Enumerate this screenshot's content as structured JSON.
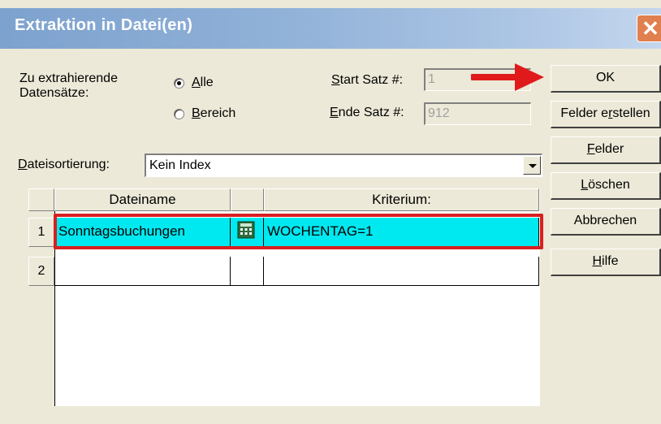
{
  "window": {
    "title": "Extraktion in Datei(en)",
    "close_symbol": "✕"
  },
  "records": {
    "label_line1": "Zu extrahierende",
    "label_line2": "Datensätze:",
    "radio_all": {
      "prefix": "",
      "accel": "A",
      "rest": "lle",
      "checked": true
    },
    "radio_range": {
      "prefix": "",
      "accel": "B",
      "rest": "ereich",
      "checked": false
    }
  },
  "start": {
    "accel": "S",
    "rest": "tart Satz #:",
    "value": "1"
  },
  "end": {
    "accel": "E",
    "rest": "nde Satz #:",
    "value": "912"
  },
  "sort": {
    "accel": "D",
    "rest": "ateisortierung:",
    "value": "Kein Index"
  },
  "buttons": {
    "ok": "OK",
    "create_pre": "Felder e",
    "create_accel": "r",
    "create_post": "stellen",
    "fields_accel": "F",
    "fields_rest": "elder",
    "delete_accel": "L",
    "delete_rest": "öschen",
    "cancel": "Abbrechen",
    "help_accel": "H",
    "help_rest": "ilfe"
  },
  "table": {
    "headers": {
      "filename": "Dateiname",
      "criterion": "Kriterium:"
    },
    "rows": [
      {
        "num": "1",
        "filename": "Sonntagsbuchungen",
        "criterion": "WOCHENTAG=1"
      },
      {
        "num": "2",
        "filename": "",
        "criterion": ""
      }
    ]
  },
  "icons": {
    "calc": "calculator-icon",
    "arrow": "red-arrow-annotation",
    "close": "close-icon"
  },
  "colors": {
    "title_bar": "#8fb0d7",
    "selection": "#00e8f0",
    "highlight": "#d81f1f",
    "dialog_bg": "#ece9d8"
  }
}
